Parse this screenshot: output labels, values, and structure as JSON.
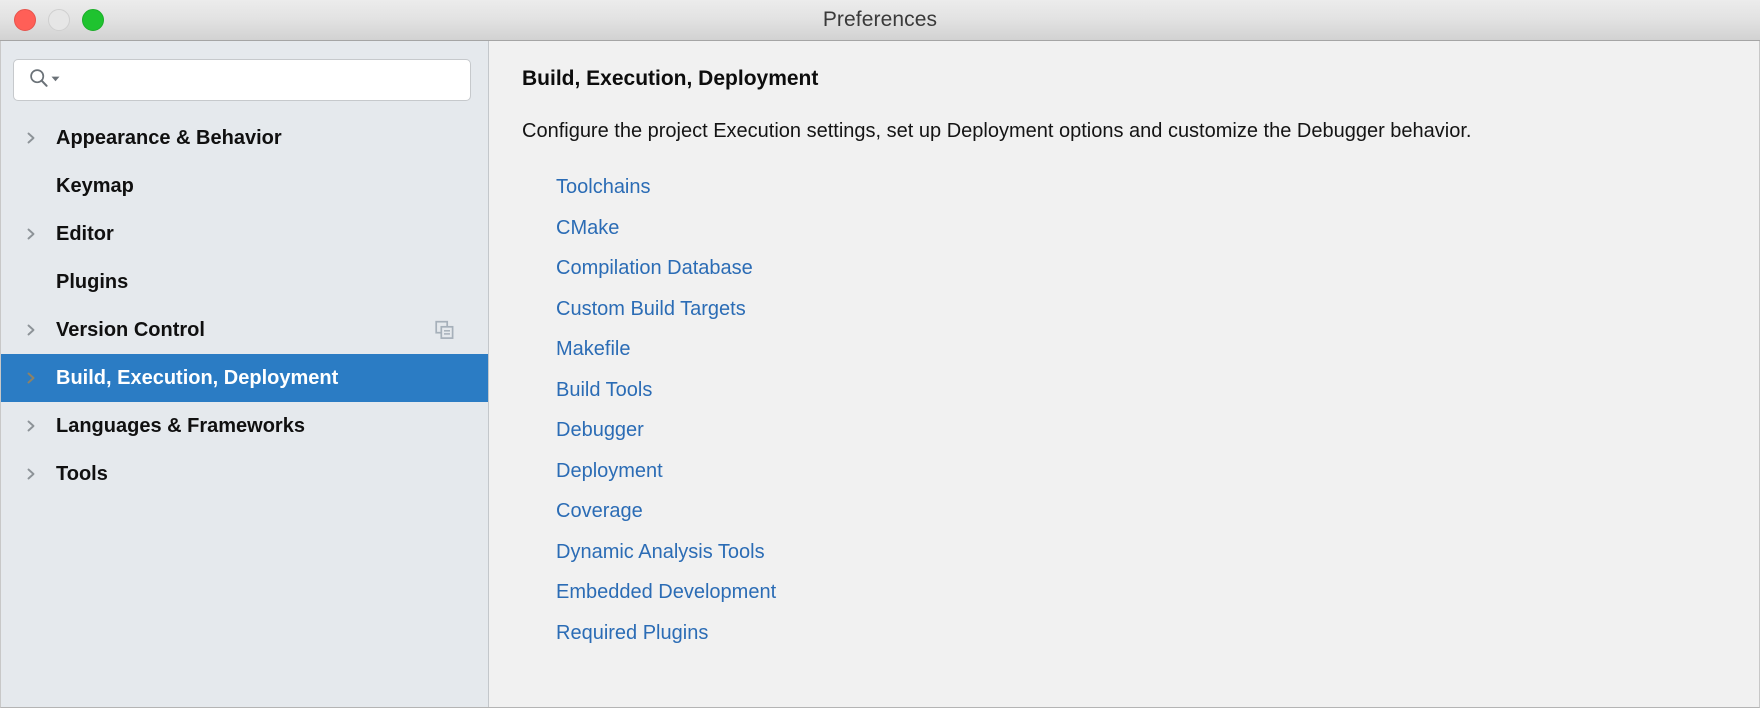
{
  "window": {
    "title": "Preferences",
    "traffic_lights": [
      {
        "name": "close-button",
        "color": "#ff5f57"
      },
      {
        "name": "minimize-button",
        "color": "#e6e6e6"
      },
      {
        "name": "maximize-button",
        "color": "#1fc32f"
      }
    ]
  },
  "sidebar": {
    "search": {
      "value": "",
      "placeholder": "",
      "icon": "search-icon",
      "dropdown_icon": "caret-down-icon"
    },
    "items": [
      {
        "label": "Appearance & Behavior",
        "expandable": true,
        "selected": false,
        "badge": null
      },
      {
        "label": "Keymap",
        "expandable": false,
        "selected": false,
        "badge": null
      },
      {
        "label": "Editor",
        "expandable": true,
        "selected": false,
        "badge": null
      },
      {
        "label": "Plugins",
        "expandable": false,
        "selected": false,
        "badge": null
      },
      {
        "label": "Version Control",
        "expandable": true,
        "selected": false,
        "badge": "copy-icon"
      },
      {
        "label": "Build, Execution, Deployment",
        "expandable": true,
        "selected": true,
        "badge": null
      },
      {
        "label": "Languages & Frameworks",
        "expandable": true,
        "selected": false,
        "badge": null
      },
      {
        "label": "Tools",
        "expandable": true,
        "selected": false,
        "badge": null
      }
    ]
  },
  "main": {
    "title": "Build, Execution, Deployment",
    "description": "Configure the project Execution settings, set up Deployment options and customize the Debugger behavior.",
    "links": [
      "Toolchains",
      "CMake",
      "Compilation Database",
      "Custom Build Targets",
      "Makefile",
      "Build Tools",
      "Debugger",
      "Deployment",
      "Coverage",
      "Dynamic Analysis Tools",
      "Embedded Development",
      "Required Plugins"
    ]
  },
  "colors": {
    "selection_blue": "#2b7cc4",
    "link_blue": "#2b6cb5",
    "sidebar_bg": "#e5e9ed",
    "main_bg": "#f1f1f1",
    "titlebar_border": "#a5a5a5"
  }
}
